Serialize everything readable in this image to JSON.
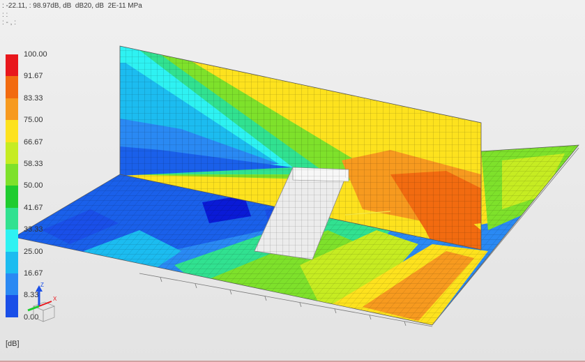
{
  "header": {
    "line1": ": -22.11, : 98.97dB, dB  dB20, dB  2E-11 MPa",
    "line2": ": :",
    "line3": ": - , :"
  },
  "legend": {
    "values": [
      "100.00",
      "91.67",
      "83.33",
      "75.00",
      "66.67",
      "58.33",
      "50.00",
      "41.67",
      "33.33",
      "25.00",
      "16.67",
      "8.33",
      "0.00"
    ],
    "colors": [
      "#e8171c",
      "#f26b10",
      "#f79a1f",
      "#fde21e",
      "#c6ec22",
      "#7ee12b",
      "#1fcc2f",
      "#31e190",
      "#2ef2f2",
      "#1cbcf0",
      "#2a89f3",
      "#1a4fe8",
      "#0a1ad6"
    ],
    "unit": "[dB]"
  },
  "triad": {
    "axis_z": "Z",
    "axis_x": "X"
  }
}
